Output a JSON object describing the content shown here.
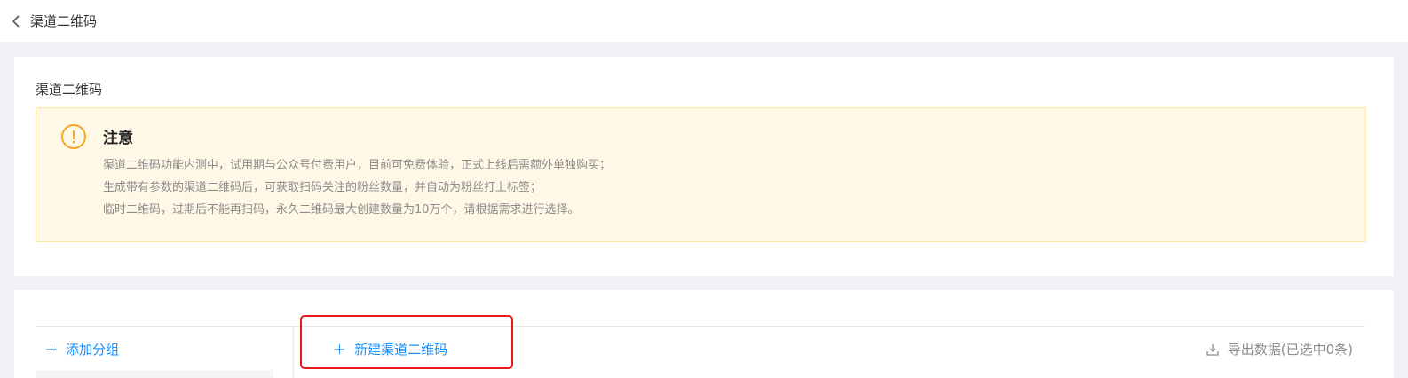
{
  "header": {
    "back_icon": "chevron-left-icon",
    "title": "渠道二维码"
  },
  "section": {
    "title": "渠道二维码"
  },
  "notice": {
    "icon": "exclamation-circle-icon",
    "title": "注意",
    "lines": [
      "渠道二维码功能内测中，试用期与公众号付费用户，目前可免费体验，正式上线后需额外单独购买；",
      "生成带有参数的渠道二维码后，可获取扫码关注的粉丝数量，并自动为粉丝打上标签；",
      "临时二维码，过期后不能再扫码，永久二维码最大创建数量为10万个，请根据需求进行选择。"
    ],
    "colors": {
      "background": "#fff8e6",
      "border": "#ffe7a3",
      "icon": "#f5a623"
    }
  },
  "toolbar": {
    "add_group_label": "添加分组",
    "new_channel_label": "新建渠道二维码",
    "export_label": "导出数据(已选中0条)",
    "plus_icon": "plus-icon",
    "export_icon": "download-icon"
  },
  "colors": {
    "accent": "#1890ff",
    "highlight": "#e8191b"
  }
}
